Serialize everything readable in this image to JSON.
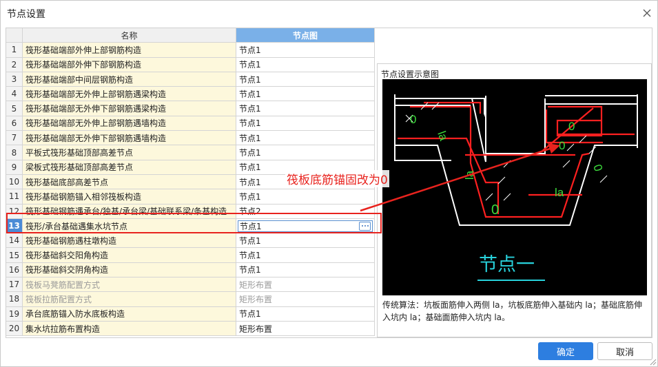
{
  "window": {
    "title": "节点设置"
  },
  "table": {
    "headers": {
      "name": "名称",
      "node": "节点图"
    },
    "rows": [
      {
        "num": "1",
        "name": "筏形基础端部外伸上部钢筋构造",
        "node": "节点1",
        "gray": false
      },
      {
        "num": "2",
        "name": "筏形基础端部外伸下部钢筋构造",
        "node": "节点1",
        "gray": false
      },
      {
        "num": "3",
        "name": "筏形基础端部中间层钢筋构造",
        "node": "节点1",
        "gray": false
      },
      {
        "num": "4",
        "name": "筏形基础端部无外伸上部钢筋遇梁构造",
        "node": "节点1",
        "gray": false
      },
      {
        "num": "5",
        "name": "筏形基础端部无外伸下部钢筋遇梁构造",
        "node": "节点1",
        "gray": false
      },
      {
        "num": "6",
        "name": "筏形基础端部无外伸上部钢筋遇墙构造",
        "node": "节点1",
        "gray": false
      },
      {
        "num": "7",
        "name": "筏形基础端部无外伸下部钢筋遇墙构造",
        "node": "节点1",
        "gray": false
      },
      {
        "num": "8",
        "name": "平板式筏形基础顶部高差节点",
        "node": "节点1",
        "gray": false
      },
      {
        "num": "9",
        "name": "梁板式筏形基础顶部高差节点",
        "node": "节点1",
        "gray": false
      },
      {
        "num": "10",
        "name": "筏形基础底部高差节点",
        "node": "节点1",
        "gray": false
      },
      {
        "num": "11",
        "name": "筏形基础钢筋锚入相邻筏板构造",
        "node": "节点1",
        "gray": false
      },
      {
        "num": "12",
        "name": "筏形基础钢筋遇承台/独基/承台梁/基础联系梁/条基构造",
        "node": "节点2",
        "gray": false
      },
      {
        "num": "13",
        "name": "筏形/承台基础遇集水坑节点",
        "node": "节点1",
        "gray": false,
        "selected": true
      },
      {
        "num": "14",
        "name": "筏形基础钢筋遇柱墩构造",
        "node": "节点1",
        "gray": false
      },
      {
        "num": "15",
        "name": "筏形基础斜交阳角构造",
        "node": "节点1",
        "gray": false
      },
      {
        "num": "16",
        "name": "筏形基础斜交阴角构造",
        "node": "节点1",
        "gray": false
      },
      {
        "num": "17",
        "name": "筏板马凳筋配置方式",
        "node": "矩形布置",
        "gray": true
      },
      {
        "num": "18",
        "name": "筏板拉筋配置方式",
        "node": "矩形布置",
        "gray": true
      },
      {
        "num": "19",
        "name": "承台底筋锚入防水底板构造",
        "node": "节点1",
        "gray": false
      },
      {
        "num": "20",
        "name": "集水坑拉筋布置构造",
        "node": "矩形布置",
        "gray": false
      }
    ]
  },
  "annotation": {
    "text": "筏板底筋锚固改为0",
    "color": "#e8231e"
  },
  "preview": {
    "title": "节点设置示意图",
    "diagram_labels": {
      "zero": "0",
      "la": "la",
      "caption": "节点一"
    },
    "description": "传统算法：坑板面筋伸入两侧 la，坑板底筋伸入基础内 la；基础底筋伸入坑内 la；基础面筋伸入坑内 la。"
  },
  "buttons": {
    "ok": "确定",
    "cancel": "取消"
  },
  "colors": {
    "accent": "#2d7ee0",
    "header_blue": "#7ab0e8",
    "name_bg": "#fdf8dc",
    "rebar_red": "#ff2020",
    "outline_white": "#ffffff",
    "label_green": "#3cdc3c",
    "caption_cyan": "#28d2dc"
  }
}
